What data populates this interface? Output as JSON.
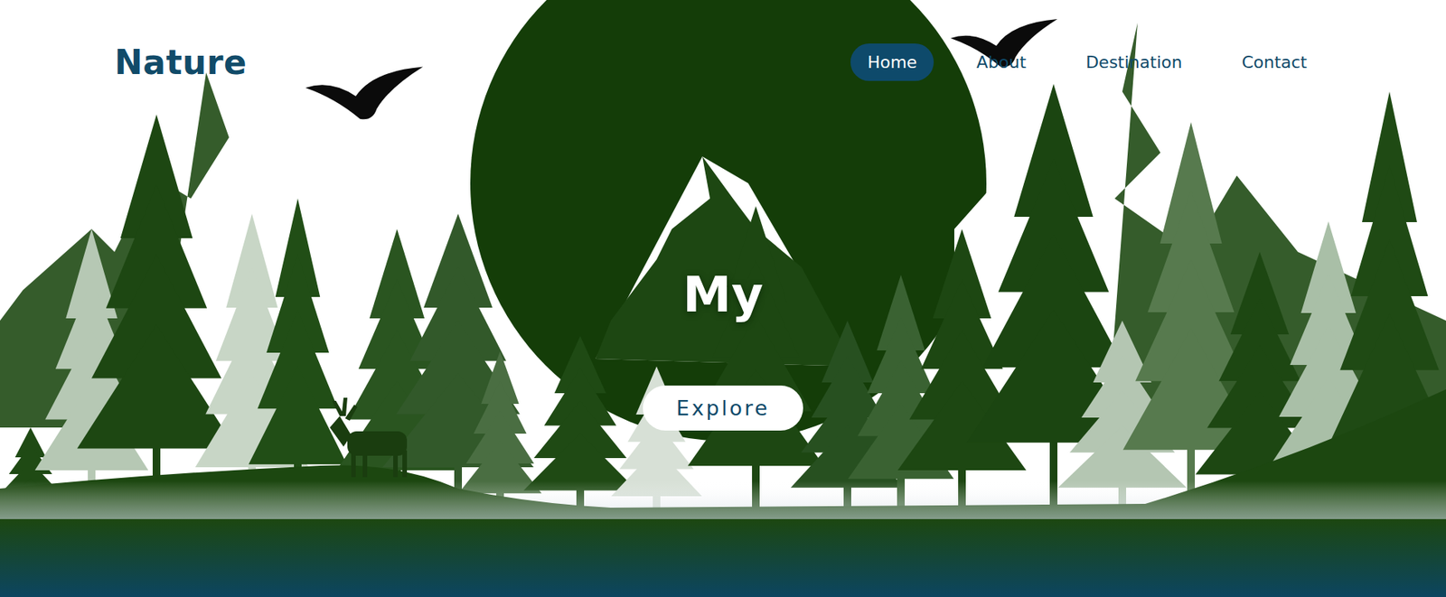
{
  "header": {
    "logo": "Nature",
    "nav": [
      {
        "label": "Home",
        "selected": true
      },
      {
        "label": "About",
        "selected": false
      },
      {
        "label": "Destination",
        "selected": false
      },
      {
        "label": "Contact",
        "selected": false
      }
    ]
  },
  "hero": {
    "title": "My",
    "button": "Explore"
  }
}
